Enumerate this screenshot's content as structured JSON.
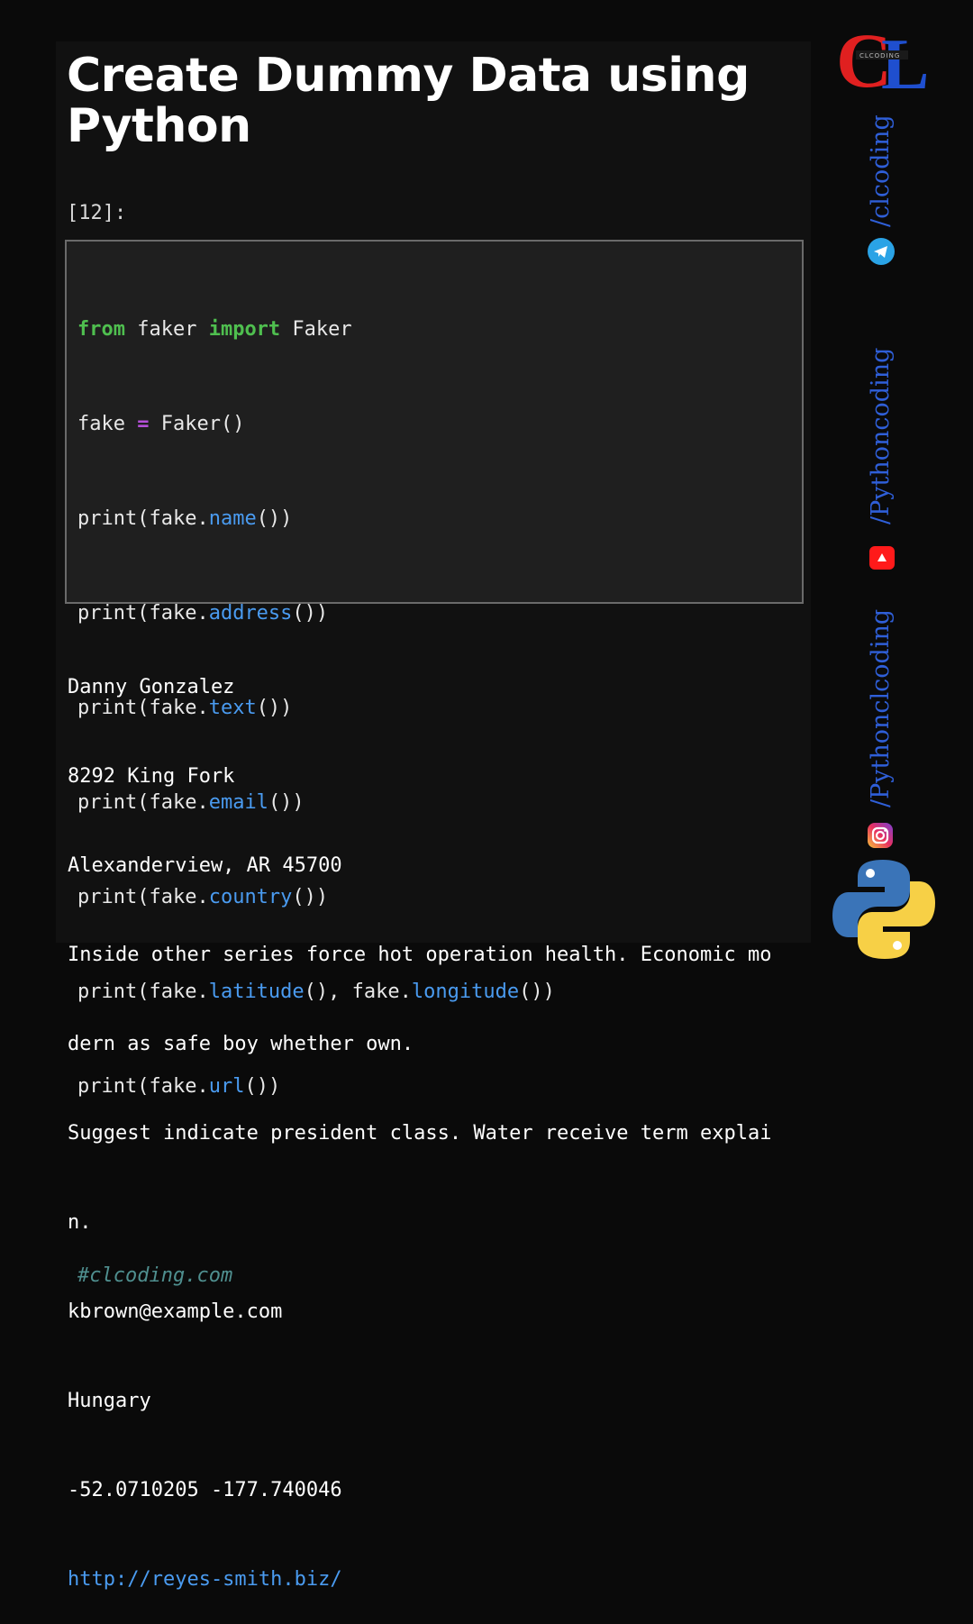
{
  "title": "Create Dummy Data using Python",
  "cell_prompt": "[12]:",
  "code": {
    "line1": {
      "kw1": "from",
      "mid": " faker ",
      "kw2": "import",
      "rest": " Faker"
    },
    "line2": {
      "pre": "fake ",
      "op": "=",
      "rest": " Faker()"
    },
    "line3": {
      "pre": "print(fake.",
      "attr": "name",
      "post": "())"
    },
    "line4": {
      "pre": "print(fake.",
      "attr": "address",
      "post": "())"
    },
    "line5": {
      "pre": "print(fake.",
      "attr": "text",
      "post": "())"
    },
    "line6": {
      "pre": "print(fake.",
      "attr": "email",
      "post": "())"
    },
    "line7": {
      "pre": "print(fake.",
      "attr": "country",
      "post": "())"
    },
    "line8": {
      "pre": "print(fake.",
      "attr1": "latitude",
      "mid": "(), fake.",
      "attr2": "longitude",
      "post": "())"
    },
    "line9": {
      "pre": "print(fake.",
      "attr": "url",
      "post": "())"
    },
    "comment": "#clcoding.com"
  },
  "output": [
    "Danny Gonzalez",
    "8292 King Fork",
    "Alexanderview, AR 45700",
    "Inside other series force hot operation health. Economic mo",
    "dern as safe boy whether own.",
    "Suggest indicate president class. Water receive term explai",
    "n.",
    "kbrown@example.com",
    "Hungary",
    "-52.0710205 -177.740046"
  ],
  "output_link": "http://reyes-smith.biz/",
  "sidebar": {
    "logo_text": "CL",
    "logo_sub": "CLCODING",
    "telegram_handle": "/clcoding",
    "youtube_handle": "/Pythoncoding",
    "instagram_handle": "/Pythonclcoding"
  },
  "colors": {
    "keyword": "#4fbf4f",
    "operator": "#b44fd8",
    "attribute": "#4a9bf0",
    "comment": "#4f8f8f",
    "handle": "#2f5fd8",
    "logo_red": "#e02020",
    "logo_blue": "#1f4fcf"
  }
}
